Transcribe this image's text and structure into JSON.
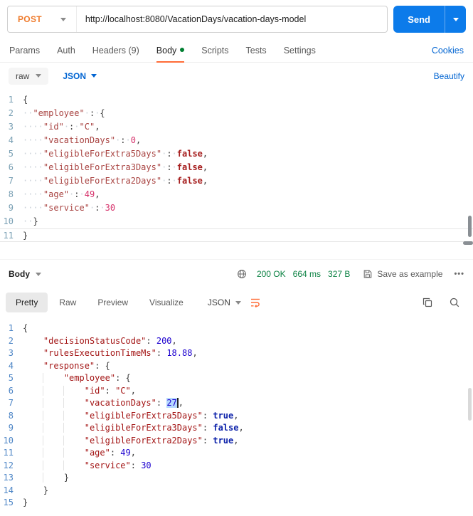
{
  "colors": {
    "accent_orange": "#FF6C37",
    "method_post_orange": "#EF7B2D",
    "send_blue": "#0C7BEA",
    "link_blue": "#0265D2",
    "status_green": "#0E8345",
    "selection_blue": "#B5D8FE"
  },
  "request_bar": {
    "method": "POST",
    "url": "http://localhost:8080/VacationDays/vacation-days-model",
    "send_label": "Send"
  },
  "request_tabs": {
    "items": [
      {
        "label": "Params"
      },
      {
        "label": "Auth"
      },
      {
        "label": "Headers (9)"
      },
      {
        "label": "Body",
        "active": true,
        "dot": true
      },
      {
        "label": "Scripts"
      },
      {
        "label": "Tests"
      },
      {
        "label": "Settings"
      }
    ],
    "cookies_label": "Cookies"
  },
  "body_toolbar": {
    "format_selected": "raw",
    "language_selected": "JSON",
    "beautify_label": "Beautify"
  },
  "request_editor": {
    "lines": [
      {
        "t": [
          [
            "p",
            "{"
          ]
        ]
      },
      {
        "t": [
          [
            "w",
            "··"
          ],
          [
            "k",
            "\"employee\""
          ],
          [
            "w",
            "·"
          ],
          [
            "p",
            ":"
          ],
          [
            "w",
            "·"
          ],
          [
            "p",
            "{"
          ]
        ]
      },
      {
        "t": [
          [
            "w",
            "····"
          ],
          [
            "k",
            "\"id\""
          ],
          [
            "w",
            "·"
          ],
          [
            "p",
            ":"
          ],
          [
            "w",
            "·"
          ],
          [
            "s",
            "\"C\""
          ],
          [
            "p",
            ","
          ]
        ]
      },
      {
        "t": [
          [
            "w",
            "····"
          ],
          [
            "k",
            "\"vacationDays\""
          ],
          [
            "w",
            "·"
          ],
          [
            "p",
            ":"
          ],
          [
            "w",
            "·"
          ],
          [
            "n",
            "0"
          ],
          [
            "p",
            ","
          ]
        ]
      },
      {
        "t": [
          [
            "w",
            "····"
          ],
          [
            "k",
            "\"eligibleForExtra5Days\""
          ],
          [
            "w",
            "·"
          ],
          [
            "p",
            ":"
          ],
          [
            "w",
            "·"
          ],
          [
            "b",
            "false"
          ],
          [
            "p",
            ","
          ]
        ]
      },
      {
        "t": [
          [
            "w",
            "····"
          ],
          [
            "k",
            "\"eligibleForExtra3Days\""
          ],
          [
            "w",
            "·"
          ],
          [
            "p",
            ":"
          ],
          [
            "w",
            "·"
          ],
          [
            "b",
            "false"
          ],
          [
            "p",
            ","
          ]
        ]
      },
      {
        "t": [
          [
            "w",
            "····"
          ],
          [
            "k",
            "\"eligibleForExtra2Days\""
          ],
          [
            "w",
            "·"
          ],
          [
            "p",
            ":"
          ],
          [
            "w",
            "·"
          ],
          [
            "b",
            "false"
          ],
          [
            "p",
            ","
          ]
        ]
      },
      {
        "t": [
          [
            "w",
            "····"
          ],
          [
            "k",
            "\"age\""
          ],
          [
            "w",
            "·"
          ],
          [
            "p",
            ":"
          ],
          [
            "w",
            "·"
          ],
          [
            "n",
            "49"
          ],
          [
            "p",
            ","
          ]
        ]
      },
      {
        "t": [
          [
            "w",
            "····"
          ],
          [
            "k",
            "\"service\""
          ],
          [
            "w",
            "·"
          ],
          [
            "p",
            ":"
          ],
          [
            "w",
            "·"
          ],
          [
            "n",
            "30"
          ]
        ]
      },
      {
        "t": [
          [
            "w",
            "··"
          ],
          [
            "p",
            "}"
          ]
        ]
      },
      {
        "current": true,
        "t": [
          [
            "p",
            "}"
          ]
        ]
      }
    ]
  },
  "response_meta": {
    "body_label": "Body",
    "status": "200 OK",
    "time": "664 ms",
    "size": "327 B",
    "save_label": "Save as example",
    "more_label": "•••"
  },
  "response_toolbar": {
    "tabs": [
      "Pretty",
      "Raw",
      "Preview",
      "Visualize"
    ],
    "active_tab": "Pretty",
    "language_selected": "JSON"
  },
  "response_editor": {
    "lines": [
      {
        "indent": 0,
        "t": [
          [
            "p",
            "{"
          ]
        ]
      },
      {
        "indent": 1,
        "t": [
          [
            "k",
            "\"decisionStatusCode\""
          ],
          [
            "p",
            ": "
          ],
          [
            "n",
            "200"
          ],
          [
            "p",
            ","
          ]
        ]
      },
      {
        "indent": 1,
        "t": [
          [
            "k",
            "\"rulesExecutionTimeMs\""
          ],
          [
            "p",
            ": "
          ],
          [
            "n",
            "18.88"
          ],
          [
            "p",
            ","
          ]
        ]
      },
      {
        "indent": 1,
        "t": [
          [
            "k",
            "\"response\""
          ],
          [
            "p",
            ": {"
          ]
        ]
      },
      {
        "indent": 2,
        "t": [
          [
            "k",
            "\"employee\""
          ],
          [
            "p",
            ": {"
          ]
        ]
      },
      {
        "indent": 3,
        "t": [
          [
            "k",
            "\"id\""
          ],
          [
            "p",
            ": "
          ],
          [
            "s",
            "\"C\""
          ],
          [
            "p",
            ","
          ]
        ]
      },
      {
        "indent": 3,
        "t": [
          [
            "k",
            "\"vacationDays\""
          ],
          [
            "p",
            ": "
          ],
          [
            "nsel",
            "27"
          ],
          [
            "p",
            ","
          ]
        ]
      },
      {
        "indent": 3,
        "t": [
          [
            "k",
            "\"eligibleForExtra5Days\""
          ],
          [
            "p",
            ": "
          ],
          [
            "b",
            "true"
          ],
          [
            "p",
            ","
          ]
        ]
      },
      {
        "indent": 3,
        "t": [
          [
            "k",
            "\"eligibleForExtra3Days\""
          ],
          [
            "p",
            ": "
          ],
          [
            "b",
            "false"
          ],
          [
            "p",
            ","
          ]
        ]
      },
      {
        "indent": 3,
        "t": [
          [
            "k",
            "\"eligibleForExtra2Days\""
          ],
          [
            "p",
            ": "
          ],
          [
            "b",
            "true"
          ],
          [
            "p",
            ","
          ]
        ]
      },
      {
        "indent": 3,
        "t": [
          [
            "k",
            "\"age\""
          ],
          [
            "p",
            ": "
          ],
          [
            "n",
            "49"
          ],
          [
            "p",
            ","
          ]
        ]
      },
      {
        "indent": 3,
        "t": [
          [
            "k",
            "\"service\""
          ],
          [
            "p",
            ": "
          ],
          [
            "n",
            "30"
          ]
        ]
      },
      {
        "indent": 2,
        "t": [
          [
            "p",
            "}"
          ]
        ]
      },
      {
        "indent": 1,
        "t": [
          [
            "p",
            "}"
          ]
        ]
      },
      {
        "indent": 0,
        "t": [
          [
            "p",
            "}"
          ]
        ]
      }
    ]
  }
}
